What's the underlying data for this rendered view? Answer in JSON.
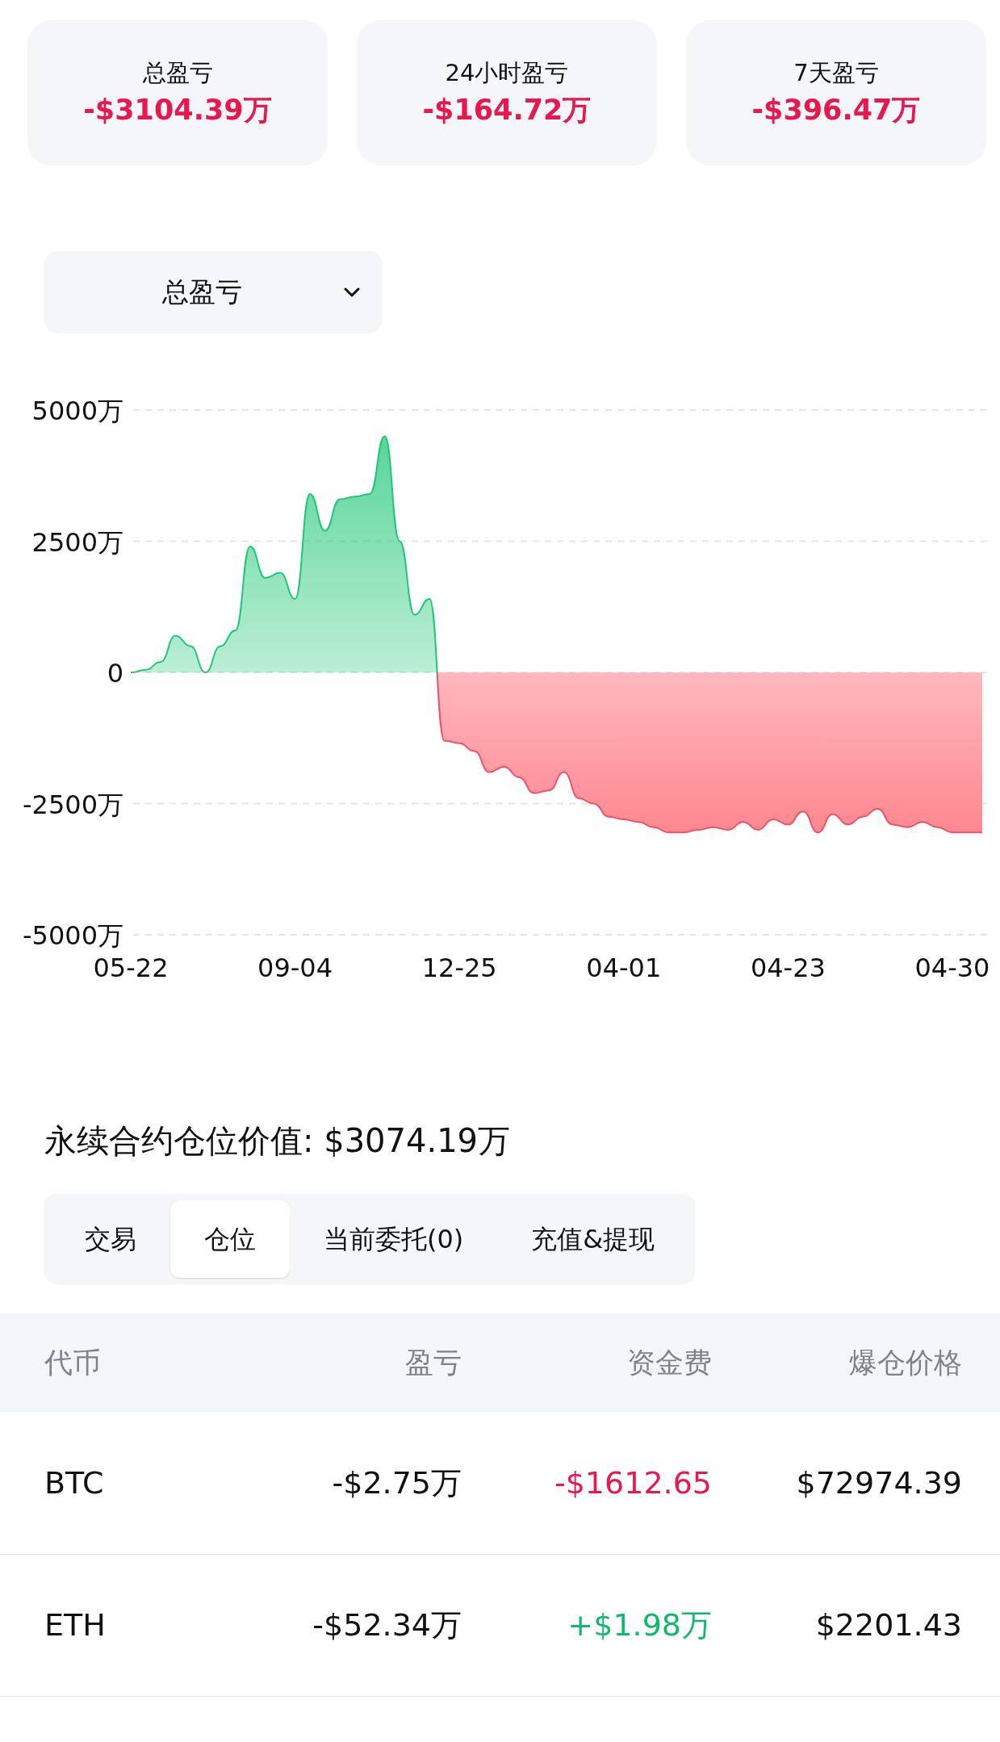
{
  "summary_cards": [
    {
      "label": "总盈亏",
      "value": "-$3104.39万"
    },
    {
      "label": "24小时盈亏",
      "value": "-$164.72万"
    },
    {
      "label": "7天盈亏",
      "value": "-$396.47万"
    }
  ],
  "metric_dropdown": {
    "value": "总盈亏"
  },
  "pnl_chart": {
    "chart_data": {
      "type": "area",
      "categories": [
        "05-22",
        null,
        null,
        null,
        null,
        null,
        null,
        null,
        null,
        null,
        null,
        "09-04",
        null,
        null,
        null,
        null,
        null,
        null,
        null,
        null,
        null,
        null,
        "12-25",
        null,
        null,
        null,
        null,
        null,
        null,
        null,
        null,
        null,
        null,
        "04-01",
        null,
        null,
        null,
        null,
        null,
        null,
        null,
        null,
        null,
        null,
        "04-23",
        null,
        null,
        null,
        null,
        null,
        null,
        null,
        null,
        null,
        null,
        "04-30",
        null,
        null
      ],
      "series": [
        {
          "color": "#1fc776",
          "values": [
            0,
            50,
            200,
            700,
            500,
            0,
            500,
            800,
            2400,
            1800,
            1900,
            1400,
            3400,
            2700,
            3300,
            3350,
            3400,
            4500,
            2500,
            1100,
            1400,
            -1300,
            -1350,
            -1500,
            -1900,
            -1800,
            -2000,
            -2300,
            -2250,
            -1900,
            -2400,
            -2500,
            -2750,
            -2800,
            -2850,
            -2950,
            -3050,
            -3050,
            -3000,
            -2950,
            -3000,
            -2850,
            -3000,
            -2800,
            -2900,
            -2650,
            -3050,
            -2700,
            -2900,
            -2750,
            -2600,
            -2900,
            -2950,
            -2850,
            -2950,
            -3050,
            -3050,
            -3050
          ]
        }
      ],
      "ylim": [
        -5000,
        5000
      ],
      "grid": true,
      "yticks": [
        {
          "value": 5000,
          "label": "5000万"
        },
        {
          "value": 2500,
          "label": "2500万"
        },
        {
          "value": 0,
          "label": "0"
        },
        {
          "value": -2500,
          "label": "-2500万"
        },
        {
          "value": -5000,
          "label": "-5000万"
        }
      ]
    }
  },
  "position_value": "永续合约仓位价值: $3074.19万",
  "tabs": [
    {
      "label": "交易",
      "selected": false
    },
    {
      "label": "仓位",
      "selected": true
    },
    {
      "label": "当前委托(0)",
      "selected": false
    },
    {
      "label": "充值&提现",
      "selected": false
    }
  ],
  "table": {
    "columns": [
      "代币",
      "盈亏",
      "资金费",
      "爆仓价格"
    ],
    "rows": [
      {
        "coin": "BTC",
        "pnl": "-$2.75万",
        "funding_fee": "-$1612.65",
        "color": "#e8174d",
        "liquidation_price": "$72974.39"
      },
      {
        "coin": "ETH",
        "pnl": "-$52.34万",
        "funding_fee": "+$1.98万",
        "color": "#14b86b",
        "liquidation_price": "$2201.43"
      }
    ]
  }
}
